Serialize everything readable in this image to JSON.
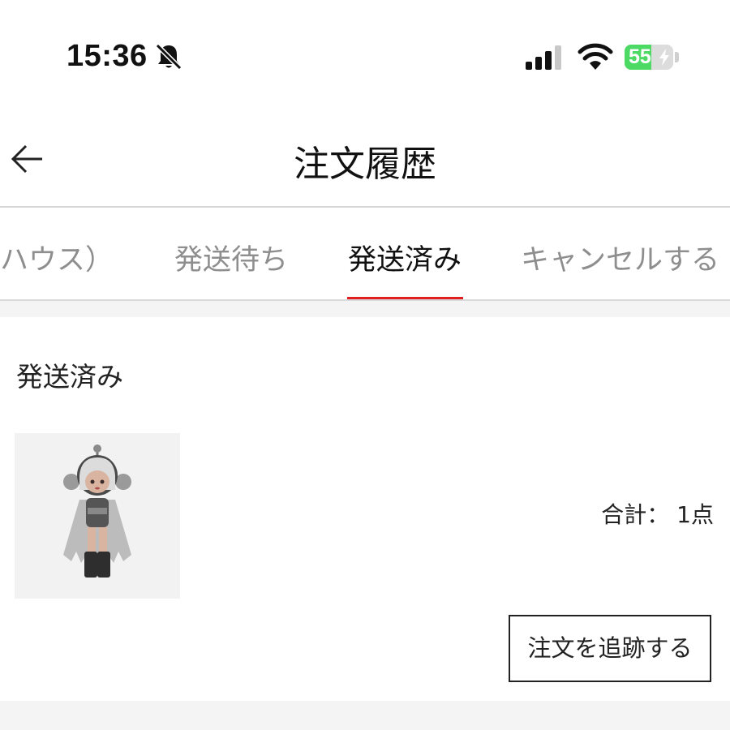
{
  "status_bar": {
    "time": "15:36",
    "battery_percent": "55",
    "battery_level": 0.55,
    "battery_color": "#4cd964",
    "icons": [
      "bell-off-icon",
      "cellular-signal-icon",
      "wifi-icon",
      "battery-charging-icon"
    ]
  },
  "header": {
    "back_icon": "arrow-left-icon",
    "title": "注文履歴"
  },
  "tabs": [
    {
      "label": "ハウス）",
      "active": false
    },
    {
      "label": "発送待ち",
      "active": false
    },
    {
      "label": "発送済み",
      "active": true
    },
    {
      "label": "キャンセルする",
      "active": false
    }
  ],
  "accent_color": "#e02020",
  "order": {
    "status": "発送済み",
    "total": "合計：  1点",
    "track_button": "注文を追跡する"
  }
}
